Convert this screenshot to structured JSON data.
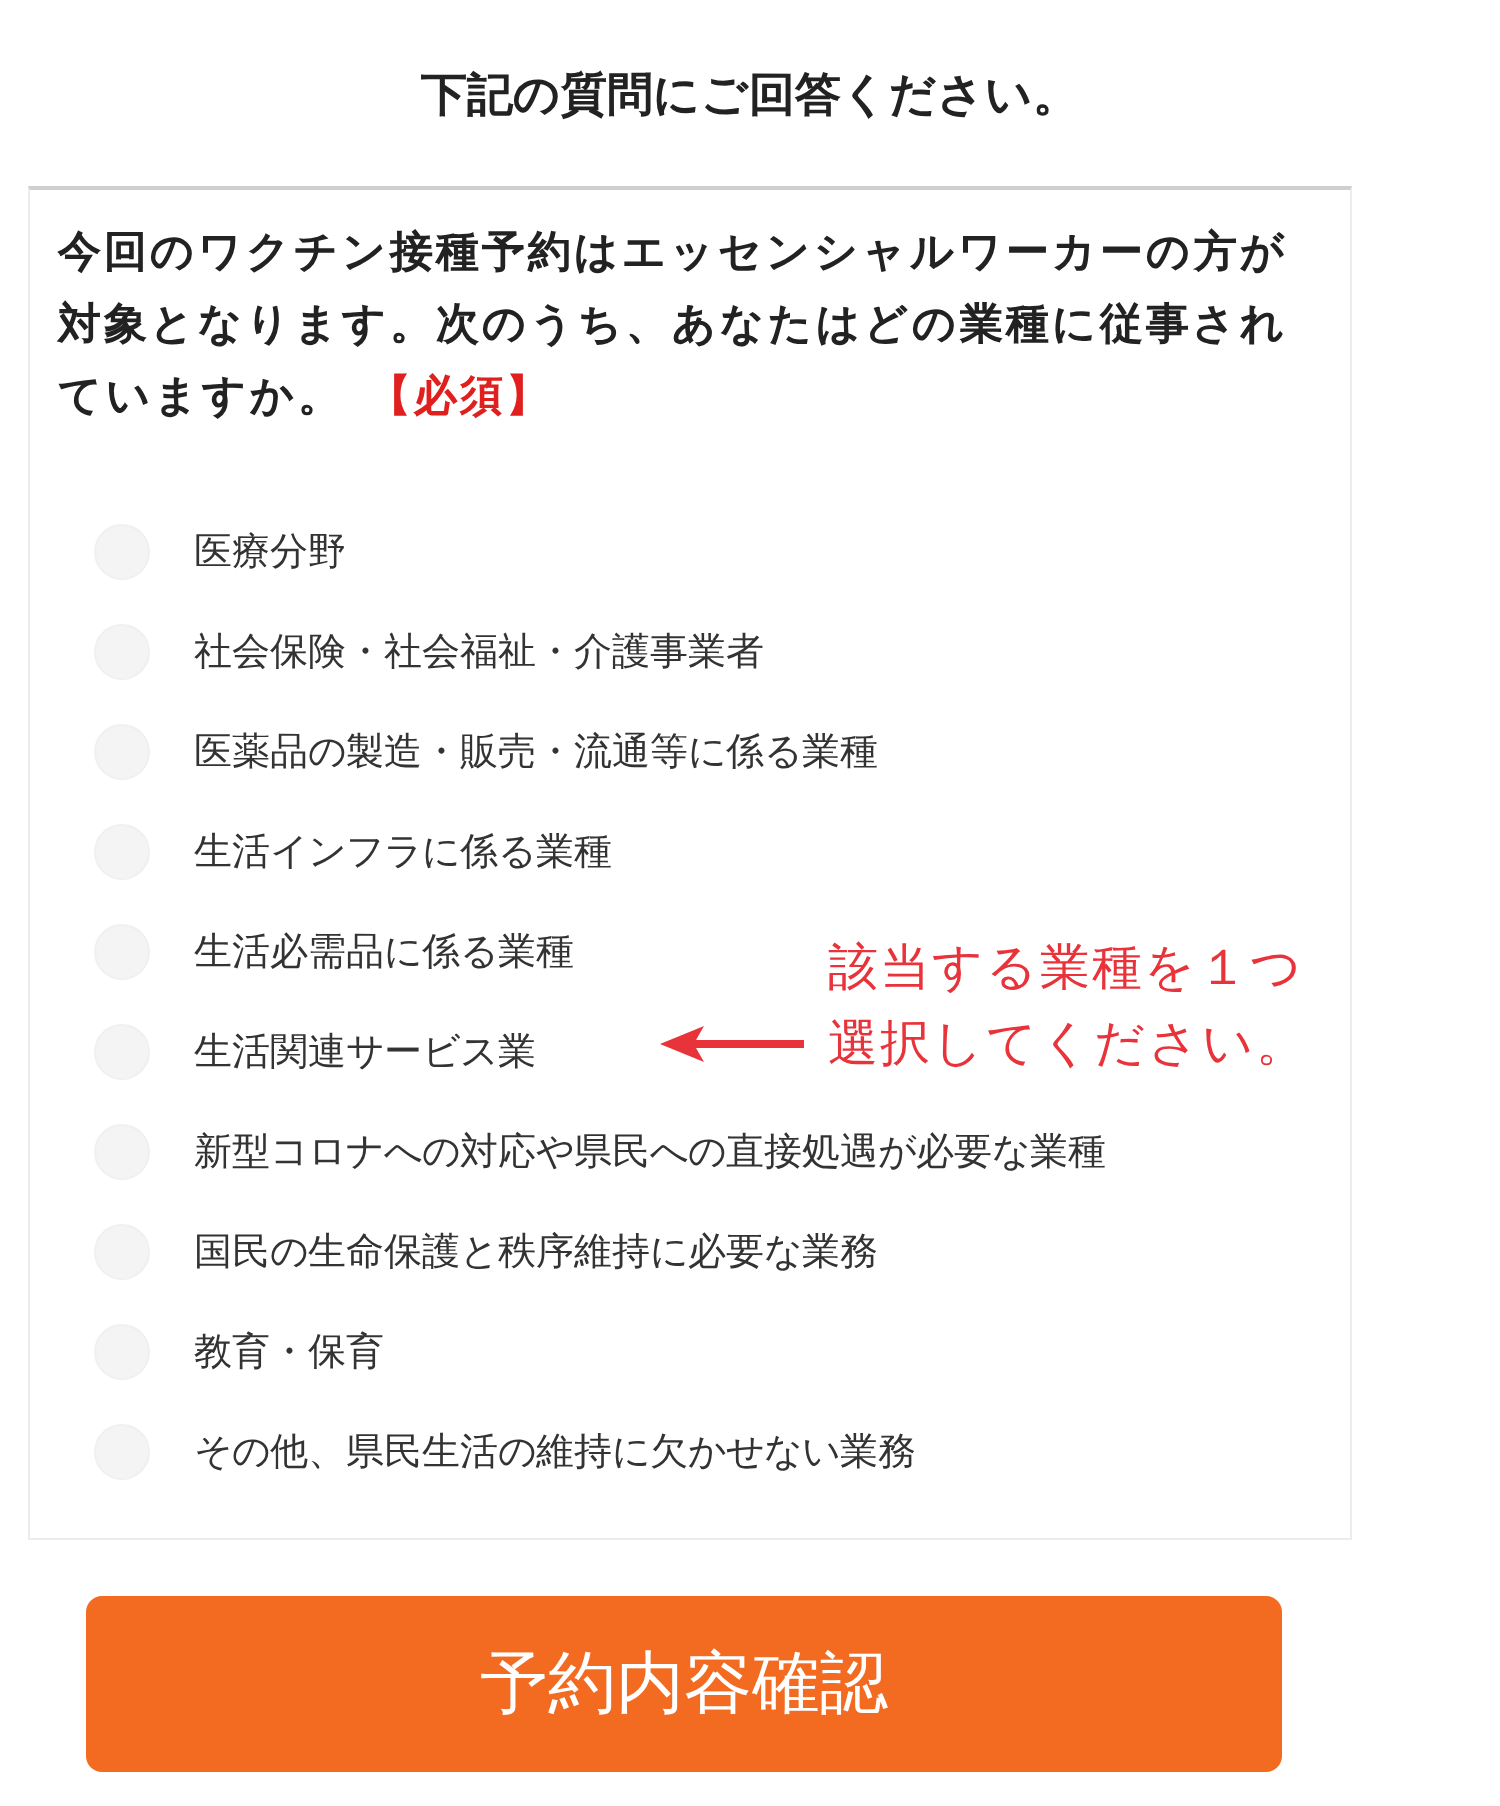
{
  "title": "下記の質問にご回答ください。",
  "question": {
    "text": "今回のワクチン接種予約はエッセンシャルワーカーの方が対象となります。次のうち、あなたはどの業種に従事されていますか。",
    "required": "【必須】"
  },
  "options": [
    {
      "label": "医療分野",
      "selected": false
    },
    {
      "label": "社会保険・社会福祉・介護事業者",
      "selected": false
    },
    {
      "label": "医薬品の製造・販売・流通等に係る業種",
      "selected": false
    },
    {
      "label": "生活インフラに係る業種",
      "selected": false
    },
    {
      "label": "生活必需品に係る業種",
      "selected": false
    },
    {
      "label": "生活関連サービス業",
      "selected": false
    },
    {
      "label": "新型コロナへの対応や県民への直接処遇が必要な業種",
      "selected": false
    },
    {
      "label": "国民の生命保護と秩序維持に必要な業務",
      "selected": false
    },
    {
      "label": "教育・保育",
      "selected": false
    },
    {
      "label": "その他、県民生活の維持に欠かせない業務",
      "selected": false
    }
  ],
  "annotation": {
    "lines": [
      "該当する業種を１つ",
      "選択してください。"
    ]
  },
  "submit_button": "予約内容確認"
}
